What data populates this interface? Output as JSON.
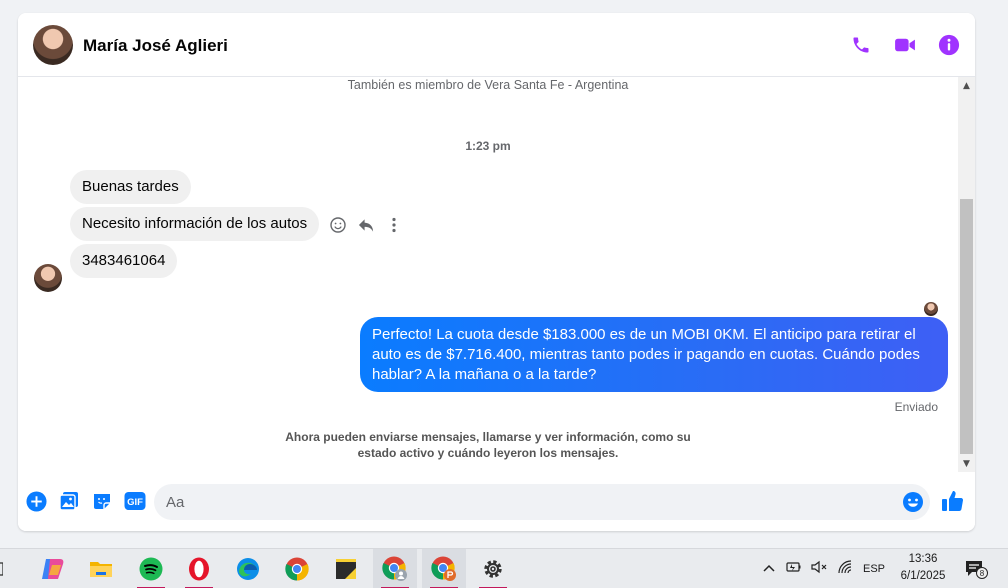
{
  "chat": {
    "contact_name": "María José Aglieri",
    "member_note": "También es miembro de Vera Santa Fe - Argentina",
    "timestamp": "1:23 pm",
    "incoming": [
      {
        "text": "Buenas tardes"
      },
      {
        "text": "Necesito información de los autos"
      },
      {
        "text": "3483461064"
      }
    ],
    "outgoing": {
      "text": "Perfecto! La cuota desde $183.000 es de un MOBI 0KM. El anticipo para retirar el auto es de $7.716.400, mientras tanto podes ir pagando en cuotas. Cuándo podes hablar? A la mañana o a la tarde?",
      "status": "Enviado"
    },
    "footer_notice": "Ahora pueden enviarse mensajes, llamarse y ver información, como su estado activo y cuándo leyeron los mensajes.",
    "accent_color": "#a033ff",
    "bubble_color": "#0a7cff"
  },
  "composer": {
    "placeholder": "Aa",
    "gif_label": "GIF"
  },
  "header_icons": [
    "phone-icon",
    "video-camera-icon",
    "info-icon"
  ],
  "taskbar": {
    "apps": [
      "widgets-icon",
      "copilot-icon",
      "file-explorer-icon",
      "spotify-icon",
      "opera-icon",
      "edge-icon",
      "chrome-icon",
      "sticky-notes-icon",
      "chrome-profile-icon",
      "chrome-profile-2-icon",
      "settings-icon"
    ],
    "language": "ESP",
    "time": "13:36",
    "date": "6/1/2025",
    "notification_count": "8"
  }
}
